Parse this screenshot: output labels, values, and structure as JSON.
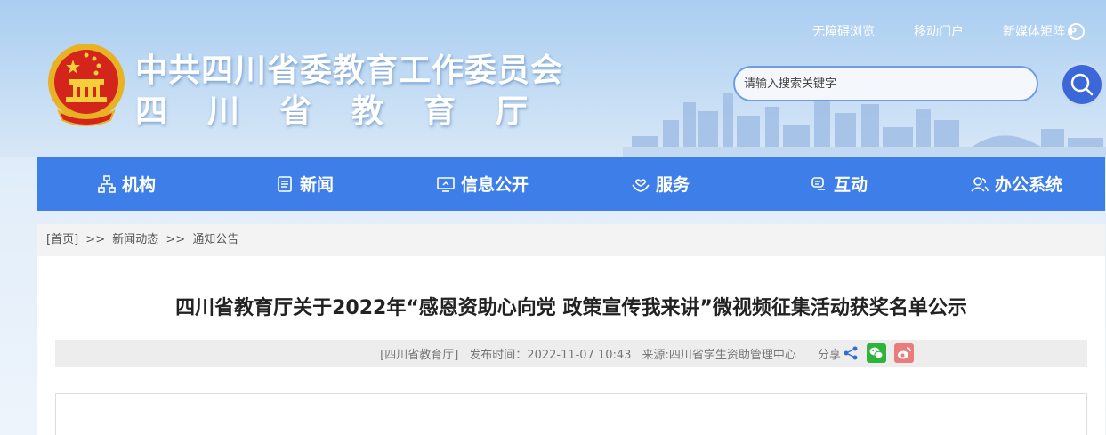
{
  "header": {
    "top_links": [
      "无障碍浏览",
      "移动门户",
      "新媒体矩阵"
    ],
    "new_media_icon": "P",
    "title_line1": "中共四川省委教育工作委员会",
    "title_line2": "四川省教育厅",
    "search_placeholder": "请输入搜索关键字"
  },
  "nav": {
    "items": [
      {
        "label": "机构",
        "icon": "org-chart-icon"
      },
      {
        "label": "新闻",
        "icon": "newspaper-icon"
      },
      {
        "label": "信息公开",
        "icon": "monitor-icon"
      },
      {
        "label": "服务",
        "icon": "hands-heart-icon"
      },
      {
        "label": "互动",
        "icon": "chat-icon"
      },
      {
        "label": "办公系统",
        "icon": "users-icon"
      }
    ]
  },
  "breadcrumb": {
    "home": "[首页]",
    "separator": ">>",
    "level1": "新闻动态",
    "level2": "通知公告"
  },
  "article": {
    "title": "四川省教育厅关于2022年“感恩资助心向党 政策宣传我来讲”微视频征集活动获奖名单公示",
    "publisher": "[四川省教育厅]",
    "publish_time": "发布时间：2022-11-07 10:43",
    "source": "来源:四川省学生资助管理中心",
    "share_label": "分享"
  },
  "colors": {
    "nav_bg": "#3d7ee8",
    "search_button": "#3b67d9",
    "wechat": "#2fb43a",
    "weibo": "#ea7c7c"
  }
}
